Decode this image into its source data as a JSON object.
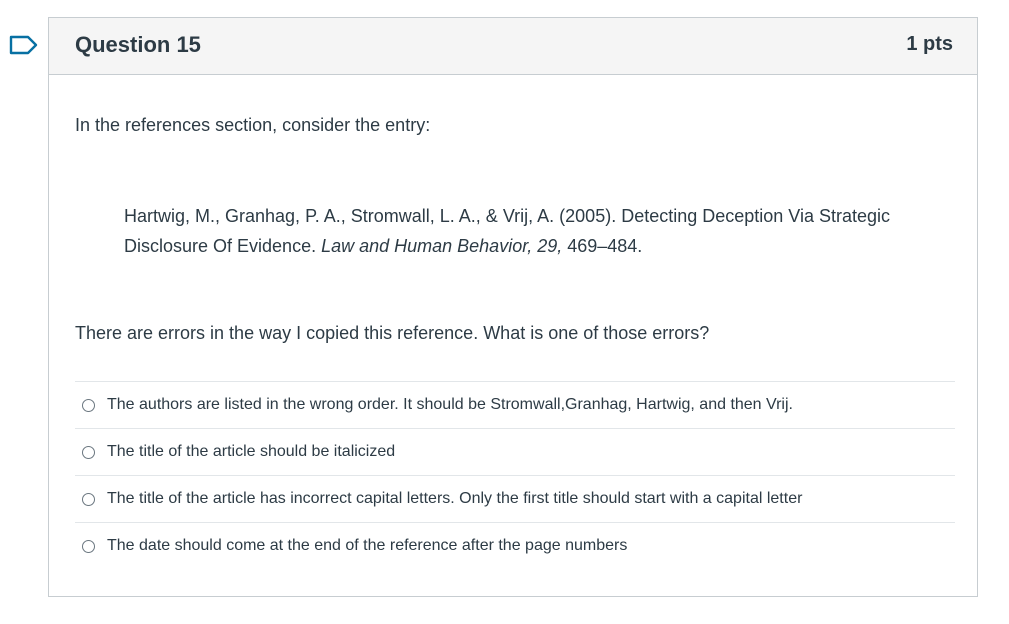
{
  "question": {
    "title": "Question 15",
    "points": "1 pts",
    "intro": "In the references section, consider the entry:",
    "reference": {
      "plain": "Hartwig, M., Granhag, P. A., Stromwall, L. A., & Vrij, A. (2005). Detecting Deception Via Strategic Disclosure Of Evidence. ",
      "journal": "Law and Human Behavior, 29,",
      "pages": " 469–484."
    },
    "prompt": "There are errors in the way I copied this reference. What is one of those errors?",
    "answers": [
      {
        "label": "The authors are listed in the wrong order. It should be Stromwall,Granhag, Hartwig, and then Vrij."
      },
      {
        "label": "The title of the article should be italicized"
      },
      {
        "label": "The title of the article has incorrect capital letters. Only the first title should start with a capital letter"
      },
      {
        "label": "The date should come at the end of the reference after the page numbers"
      }
    ]
  },
  "colors": {
    "header_bg": "#f5f5f5",
    "border": "#c7cdd1",
    "text": "#2d3b45",
    "flag": "#0770a3"
  }
}
